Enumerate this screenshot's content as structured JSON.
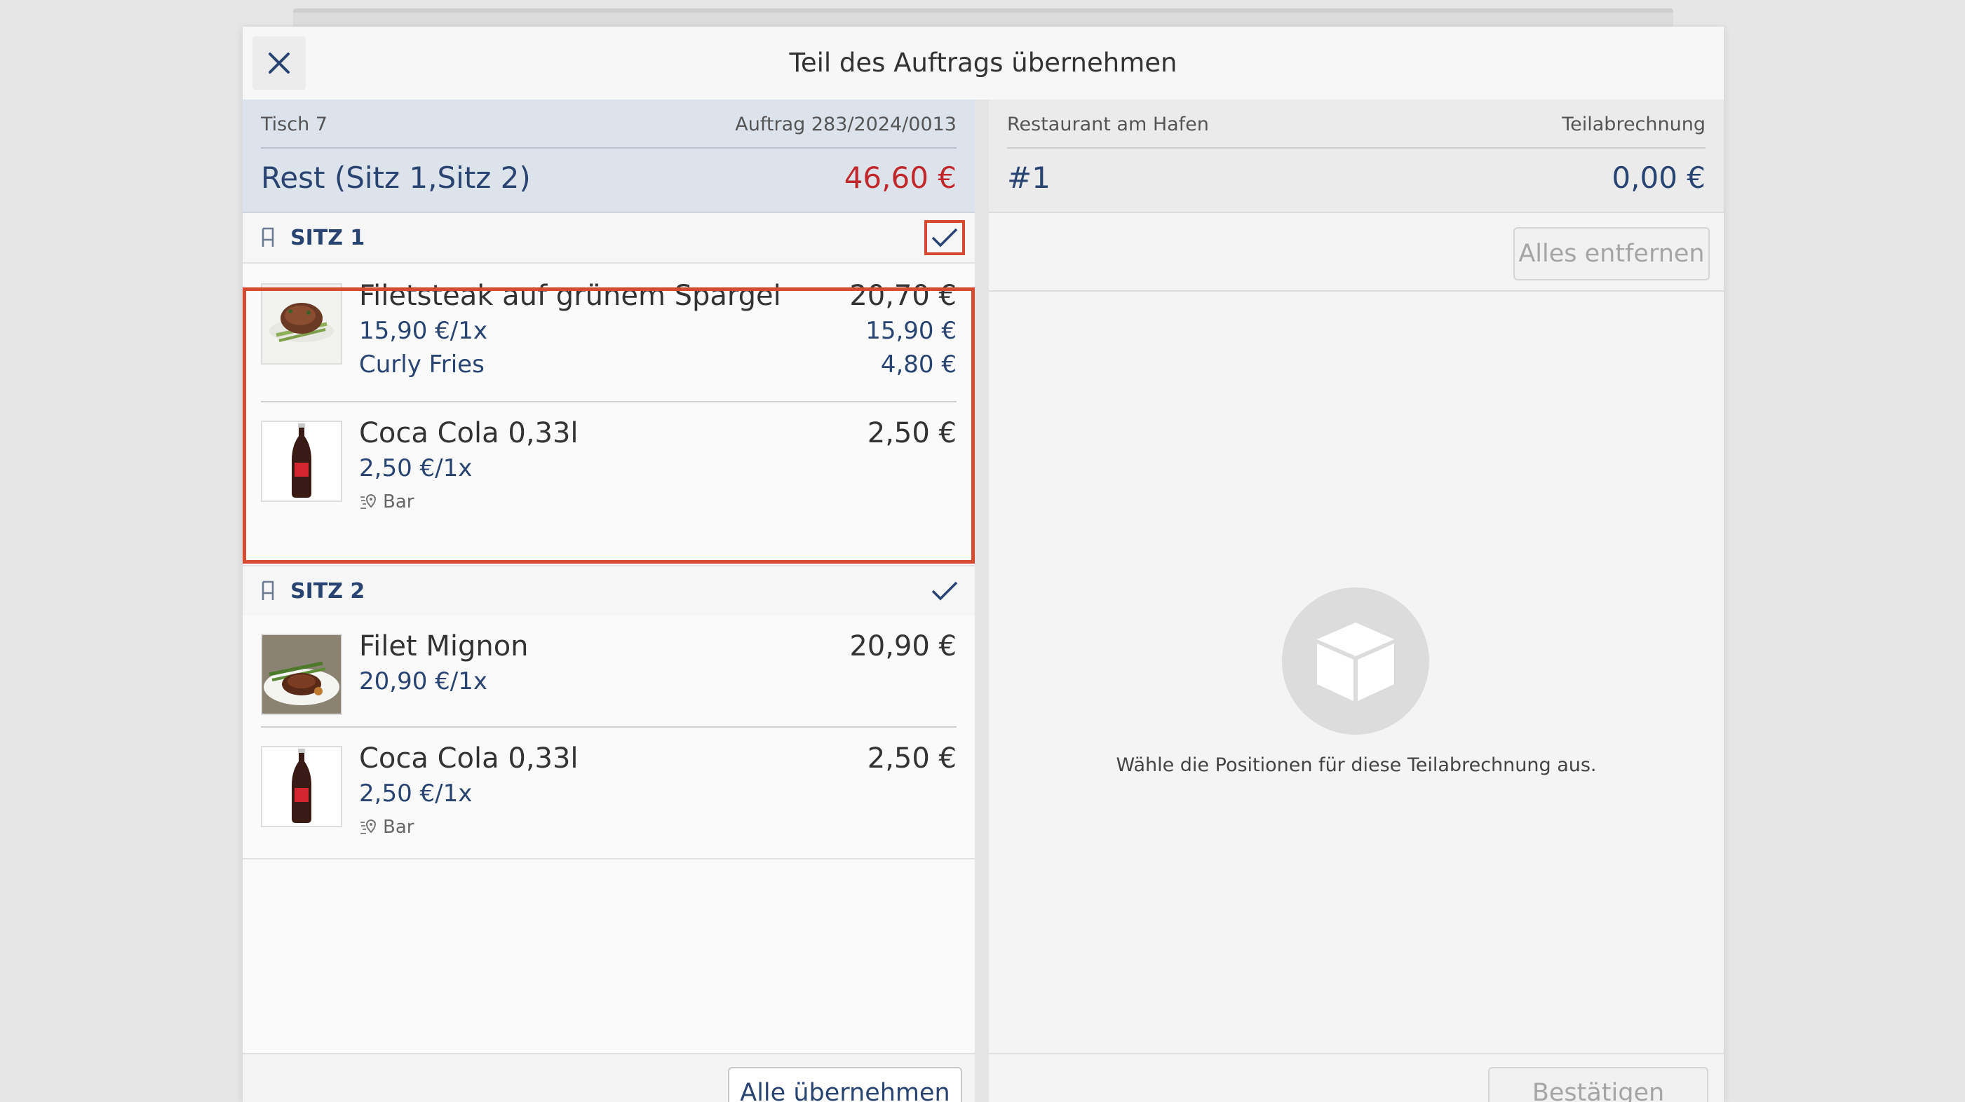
{
  "dialog": {
    "title": "Teil des Auftrags übernehmen",
    "close_icon": "close-icon"
  },
  "left": {
    "table": "Tisch 7",
    "order": "Auftrag 283/2024/0013",
    "heading": "Rest (Sitz 1,Sitz 2)",
    "total": "46,60 €",
    "seats": [
      {
        "label": "SITZ 1",
        "checked": true,
        "items": [
          {
            "name": "Filetsteak auf grünem Spargel",
            "price": "20,70 €",
            "unit": "15,90 €/1x",
            "unit_price": "15,90 €",
            "extra": "Curly Fries",
            "extra_price": "4,80 €"
          },
          {
            "name": "Coca Cola 0,33l",
            "price": "2,50 €",
            "unit": "2,50 €/1x",
            "location": "Bar"
          }
        ]
      },
      {
        "label": "SITZ 2",
        "checked": true,
        "items": [
          {
            "name": "Filet Mignon",
            "price": "20,90 €",
            "unit": "20,90 €/1x"
          },
          {
            "name": "Coca Cola 0,33l",
            "price": "2,50 €",
            "unit": "2,50 €/1x",
            "location": "Bar"
          }
        ]
      }
    ],
    "footer_button": "Alle übernehmen"
  },
  "right": {
    "restaurant": "Restaurant am Hafen",
    "type": "Teilabrechnung",
    "number": "#1",
    "total": "0,00 €",
    "remove_button": "Alles entfernen",
    "empty_text": "Wähle die Positionen für diese Teilabrechnung aus.",
    "confirm_button": "Bestätigen"
  },
  "colors": {
    "accent": "#2a4472",
    "total_red": "#c0282d",
    "highlight": "#d64a2f"
  }
}
